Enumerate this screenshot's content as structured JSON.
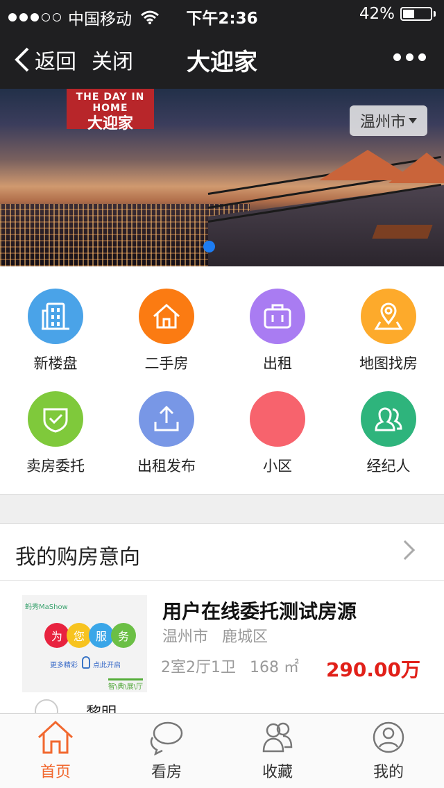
{
  "status_bar": {
    "carrier": "中国移动",
    "time": "下午2:36",
    "battery": "42%",
    "battery_level": 0.42
  },
  "nav": {
    "back_label": "返回",
    "close_label": "关闭",
    "title": "大迎家"
  },
  "banner": {
    "logo_top": "THE DAY IN HOME",
    "logo_main": "大迎家",
    "city": "温州市",
    "page_count": 1,
    "current_page": 1
  },
  "grid": [
    {
      "label": "新楼盘",
      "icon": "building-icon",
      "color": "#4aa3e8"
    },
    {
      "label": "二手房",
      "icon": "house-icon",
      "color": "#fb7b12"
    },
    {
      "label": "出租",
      "icon": "suitcase-icon",
      "color": "#a97cf2"
    },
    {
      "label": "地图找房",
      "icon": "map-pin-icon",
      "color": "#fdaa2b"
    },
    {
      "label": "卖房委托",
      "icon": "shield-check-icon",
      "color": "#7fc93b"
    },
    {
      "label": "出租发布",
      "icon": "upload-icon",
      "color": "#7897e6"
    },
    {
      "label": "小区",
      "icon": "community-icon",
      "color": "#f7636d"
    },
    {
      "label": "经纪人",
      "icon": "agents-icon",
      "color": "#2eb47c"
    }
  ],
  "intent": {
    "title": "我的购房意向"
  },
  "listing": {
    "thumb_brand": "蚂秀MaShow",
    "thumb_words": [
      "为",
      "您",
      "服",
      "务"
    ],
    "thumb_sub1": "更多精彩",
    "thumb_sub2": "点此开启",
    "thumb_foot": "智\\典\\展\\厅",
    "title": "用户在线委托测试房源",
    "city": "温州市",
    "district": "鹿城区",
    "layout": "2室2厅1卫",
    "area": "168 ㎡",
    "price": "290.00万",
    "next_name": "黎明"
  },
  "tabbar": [
    {
      "label": "首页",
      "icon": "home-icon",
      "active": true
    },
    {
      "label": "看房",
      "icon": "chat-bubble-icon",
      "active": false
    },
    {
      "label": "收藏",
      "icon": "favorites-icon",
      "active": false
    },
    {
      "label": "我的",
      "icon": "profile-icon",
      "active": false
    }
  ]
}
